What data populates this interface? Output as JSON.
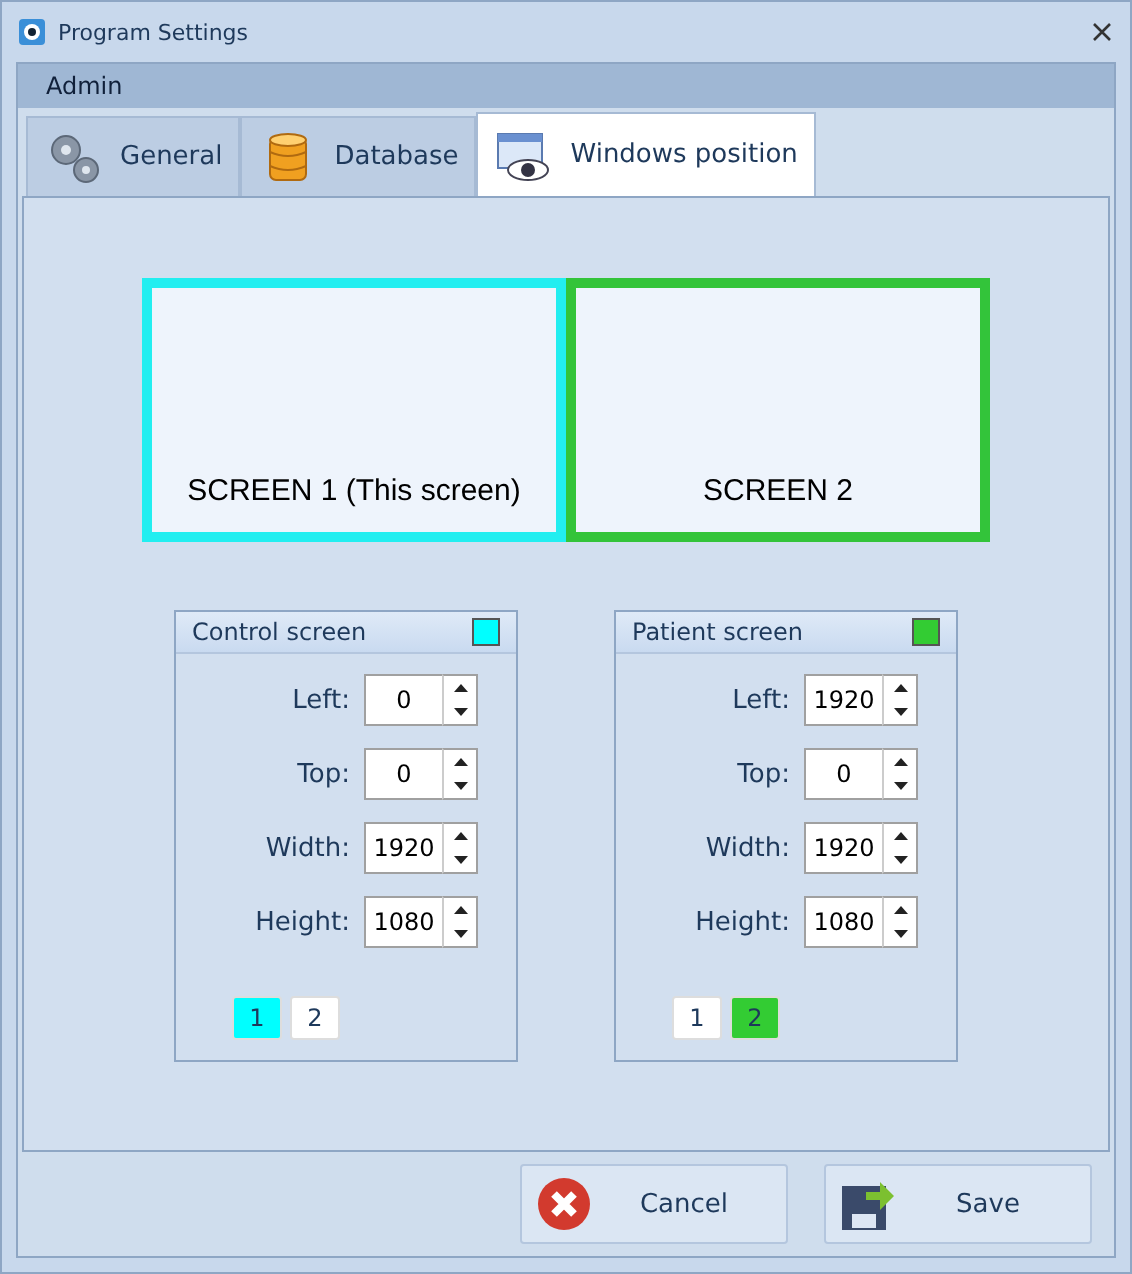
{
  "window": {
    "title": "Program Settings"
  },
  "menu": [
    "Admin"
  ],
  "tabs": [
    {
      "label": "General",
      "selected": false
    },
    {
      "label": "Database",
      "selected": false
    },
    {
      "label": "Windows position",
      "selected": true
    }
  ],
  "screens": [
    {
      "label": "SCREEN 1 (This screen)",
      "color": "#22eef0"
    },
    {
      "label": "SCREEN 2",
      "color": "#33c43a"
    }
  ],
  "panels": [
    {
      "title": "Control screen",
      "color": "#00ffff",
      "fields": [
        {
          "label": "Left:",
          "value": "0"
        },
        {
          "label": "Top:",
          "value": "0"
        },
        {
          "label": "Width:",
          "value": "1920"
        },
        {
          "label": "Height:",
          "value": "1080"
        }
      ],
      "screen_buttons": [
        {
          "label": "1",
          "selected": true
        },
        {
          "label": "2",
          "selected": false
        }
      ]
    },
    {
      "title": "Patient screen",
      "color": "#33cc33",
      "fields": [
        {
          "label": "Left:",
          "value": "1920"
        },
        {
          "label": "Top:",
          "value": "0"
        },
        {
          "label": "Width:",
          "value": "1920"
        },
        {
          "label": "Height:",
          "value": "1080"
        }
      ],
      "screen_buttons": [
        {
          "label": "1",
          "selected": false
        },
        {
          "label": "2",
          "selected": true
        }
      ]
    }
  ],
  "buttons": [
    {
      "label": "Cancel",
      "kind": "cancel"
    },
    {
      "label": "Save",
      "kind": "save"
    }
  ]
}
